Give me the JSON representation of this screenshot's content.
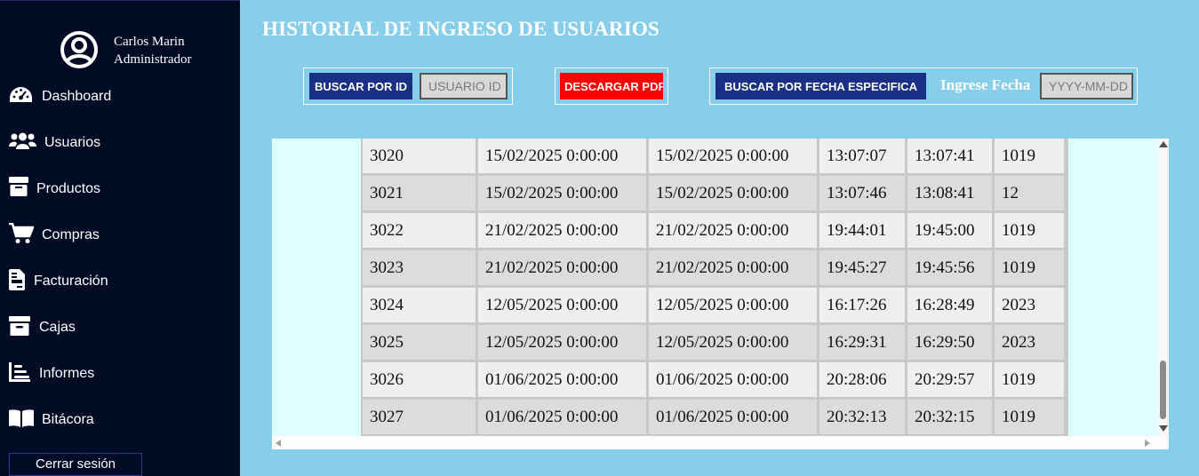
{
  "user": {
    "name": "Carlos Marin",
    "role": "Administrador",
    "icon": "user-circle-icon"
  },
  "sidebar": {
    "items": [
      {
        "label": "Dashboard",
        "icon": "dashboard-gauge-icon"
      },
      {
        "label": "Usuarios",
        "icon": "users-icon"
      },
      {
        "label": "Productos",
        "icon": "box-icon"
      },
      {
        "label": "Compras",
        "icon": "cart-icon"
      },
      {
        "label": "Facturación",
        "icon": "invoice-icon"
      },
      {
        "label": "Cajas",
        "icon": "archive-box-icon"
      },
      {
        "label": "Informes",
        "icon": "chart-list-icon"
      },
      {
        "label": "Bitácora",
        "icon": "book-icon"
      }
    ],
    "logout_label": "Cerrar sesión"
  },
  "page": {
    "title": "HISTORIAL DE INGRESO DE USUARIOS"
  },
  "toolbar": {
    "search_id_label": "BUSCAR POR ID",
    "search_id_placeholder": "USUARIO ID",
    "download_pdf_label": "DESCARGAR PDF",
    "search_date_label": "BUSCAR POR FECHA ESPECIFICA",
    "date_prompt": "Ingrese Fecha",
    "date_placeholder": "YYYY-MM-DD"
  },
  "table": {
    "rows": [
      [
        "3020",
        "15/02/2025 0:00:00",
        "15/02/2025 0:00:00",
        "13:07:07",
        "13:07:41",
        "1019"
      ],
      [
        "3021",
        "15/02/2025 0:00:00",
        "15/02/2025 0:00:00",
        "13:07:46",
        "13:08:41",
        "12"
      ],
      [
        "3022",
        "21/02/2025 0:00:00",
        "21/02/2025 0:00:00",
        "19:44:01",
        "19:45:00",
        "1019"
      ],
      [
        "3023",
        "21/02/2025 0:00:00",
        "21/02/2025 0:00:00",
        "19:45:27",
        "19:45:56",
        "1019"
      ],
      [
        "3024",
        "12/05/2025 0:00:00",
        "12/05/2025 0:00:00",
        "16:17:26",
        "16:28:49",
        "2023"
      ],
      [
        "3025",
        "12/05/2025 0:00:00",
        "12/05/2025 0:00:00",
        "16:29:31",
        "16:29:50",
        "2023"
      ],
      [
        "3026",
        "01/06/2025 0:00:00",
        "01/06/2025 0:00:00",
        "20:28:06",
        "20:29:57",
        "1019"
      ],
      [
        "3027",
        "01/06/2025 0:00:00",
        "01/06/2025 0:00:00",
        "20:32:13",
        "20:32:15",
        "1019"
      ]
    ]
  },
  "colors": {
    "sidebar_bg": "#020b24",
    "page_bg": "#87ceeb",
    "button_blue": "#1a2f86",
    "button_red": "#ff0000",
    "table_area_bg": "#dfffff"
  }
}
